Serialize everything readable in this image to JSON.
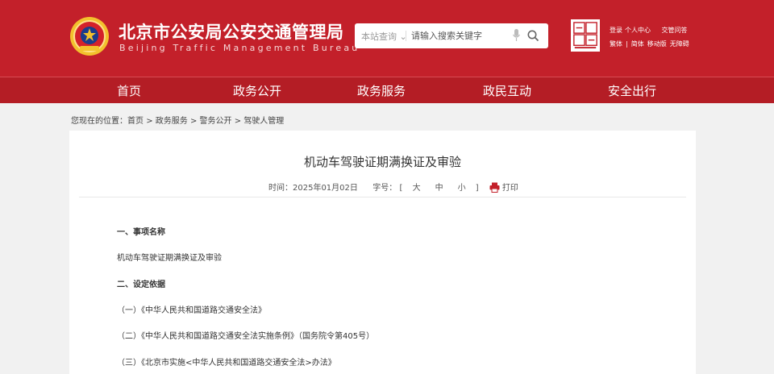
{
  "header": {
    "title": "北京市公安局公安交通管理局",
    "subtitle": "Beijing Traffic Management Bureau",
    "search": {
      "scope": "本站查询",
      "placeholder": "请输入搜索关键字"
    },
    "links_row1": [
      "登录",
      "个人中心",
      "交管问答"
    ],
    "links_row2": [
      "繁体",
      "|",
      "简体",
      "移动版",
      "无障碍"
    ],
    "logo_icon": "beijing-china-capital-logo",
    "emblem_icon": "police-emblem"
  },
  "nav": {
    "items": [
      "首页",
      "政务公开",
      "政务服务",
      "政民互动",
      "安全出行"
    ]
  },
  "breadcrumb": {
    "prefix": "您现在的位置：",
    "items": [
      "首页",
      "政务服务",
      "警务公开",
      "驾驶人管理"
    ],
    "separator": ">"
  },
  "article": {
    "title": "机动车驾驶证期满换证及审验",
    "time_label": "时间：",
    "time_value": "2025年01月02日",
    "font_label": "字号：",
    "bracket_open": "[",
    "size_large": "大",
    "size_medium": "中",
    "size_small": "小",
    "bracket_close": "]",
    "print_label": "打印",
    "paragraphs": [
      "一、事项名称",
      "机动车驾驶证期满换证及审验",
      "二、设定依据",
      "（一）《中华人民共和国道路交通安全法》",
      "（二）《中华人民共和国道路交通安全法实施条例》（国务院令第405号）",
      "（三）《北京市实施<中华人民共和国道路交通安全法>办法》"
    ]
  },
  "colors": {
    "brand_red": "#c3202a",
    "nav_red": "#b41d25",
    "page_bg": "#f1f1f1"
  }
}
